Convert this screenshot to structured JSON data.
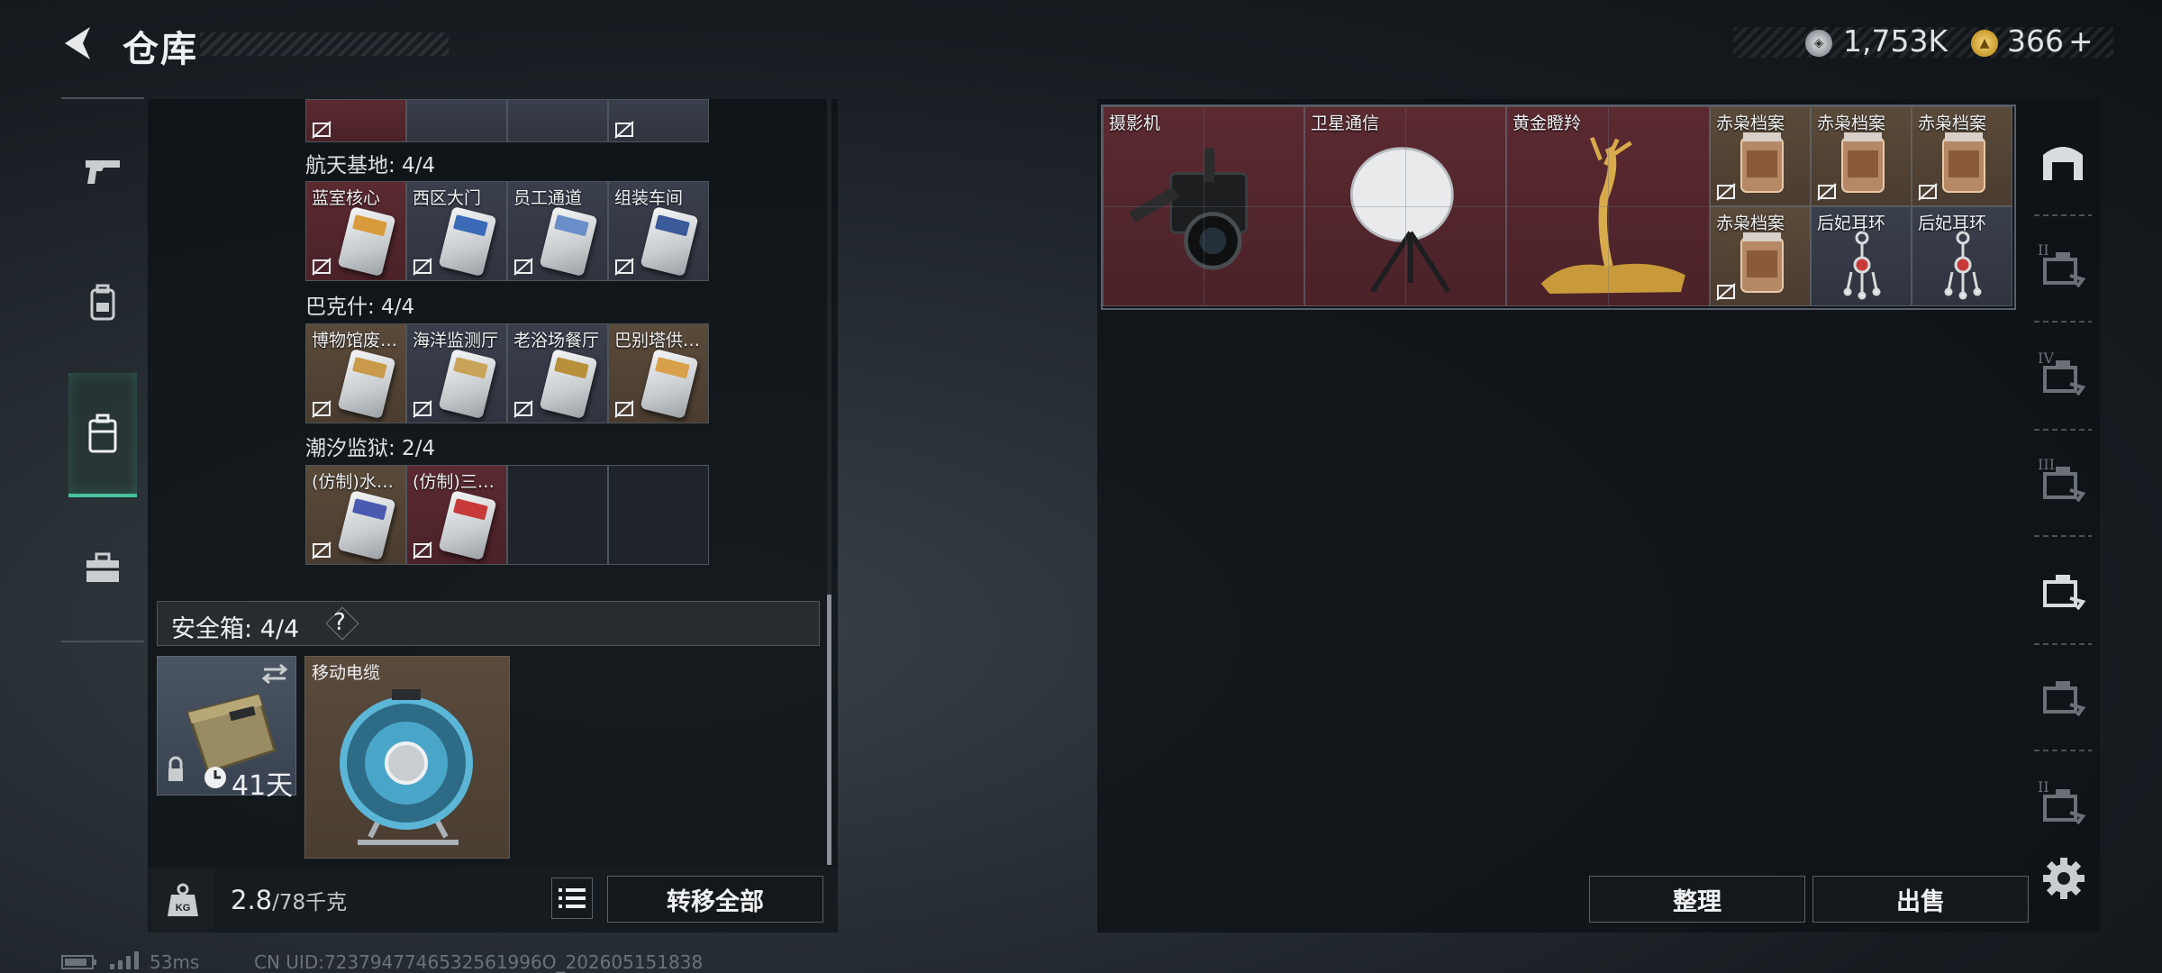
{
  "header": {
    "title": "仓库",
    "currency1": "1,753K",
    "currency2": "366",
    "currency2_suffix": "+"
  },
  "left_nav": {
    "items": [
      {
        "icon": "pistol-icon",
        "active": false
      },
      {
        "icon": "backpack-icon",
        "active": false
      },
      {
        "icon": "safe-case-icon",
        "active": true
      },
      {
        "icon": "toolbox-icon",
        "active": false
      }
    ]
  },
  "keycard_groups": [
    {
      "title": "航天基地: 4/4",
      "slots": [
        {
          "label": "蓝室核心",
          "bg": "red"
        },
        {
          "label": "西区大门",
          "bg": "gray"
        },
        {
          "label": "员工通道",
          "bg": "gray"
        },
        {
          "label": "组装车间",
          "bg": "gray"
        }
      ]
    },
    {
      "title": "巴克什: 4/4",
      "slots": [
        {
          "label": "博物馆废…",
          "bg": "brown"
        },
        {
          "label": "海洋监测厅",
          "bg": "gray"
        },
        {
          "label": "老浴场餐厅",
          "bg": "gray"
        },
        {
          "label": "巴别塔供…",
          "bg": "brown"
        }
      ]
    },
    {
      "title": "潮汐监狱: 2/4",
      "slots": [
        {
          "label": "(仿制)水…",
          "bg": "brown"
        },
        {
          "label": "(仿制)三…",
          "bg": "red"
        },
        {
          "label": "",
          "bg": "empty"
        },
        {
          "label": "",
          "bg": "empty"
        }
      ]
    }
  ],
  "safe_box": {
    "title": "安全箱: 4/4",
    "help": "?",
    "days": "41天",
    "item_label": "移动电缆"
  },
  "capacity": {
    "current": "2.8",
    "max": "/78千克",
    "kg_icon": "KG"
  },
  "buttons": {
    "transfer_all": "转移全部",
    "sort": "整理",
    "sell": "出售"
  },
  "storage_items": [
    {
      "label": "摄影机",
      "bg": "red",
      "icon": "camera-icon"
    },
    {
      "label": "卫星通信",
      "bg": "red",
      "icon": "satellite-dish-icon"
    },
    {
      "label": "黄金瞪羚",
      "bg": "red",
      "icon": "golden-gazelle-icon"
    },
    {
      "label": "赤枭档案",
      "bg": "brown",
      "icon": "archive-jar-icon"
    },
    {
      "label": "赤枭档案",
      "bg": "brown",
      "icon": "archive-jar-icon"
    },
    {
      "label": "赤枭档案",
      "bg": "brown",
      "icon": "archive-jar-icon"
    },
    {
      "label": "赤枭档案",
      "bg": "brown",
      "icon": "archive-jar-icon"
    },
    {
      "label": "后妃耳环",
      "bg": "gray",
      "icon": "earring-icon"
    },
    {
      "label": "后妃耳环",
      "bg": "gray",
      "icon": "earring-icon"
    }
  ],
  "right_nav": {
    "items": [
      {
        "icon": "container-icon",
        "roman": ""
      },
      {
        "icon": "add-storage-icon",
        "roman": "II"
      },
      {
        "icon": "storage-iv-icon",
        "roman": "IV"
      },
      {
        "icon": "storage-iii-icon",
        "roman": "III"
      },
      {
        "icon": "storage-active-icon",
        "roman": ""
      },
      {
        "icon": "storage-dim-icon",
        "roman": ""
      },
      {
        "icon": "storage-ii-icon",
        "roman": "II"
      }
    ]
  },
  "footer": {
    "ping": "53ms",
    "uid": "CN UID:7237947746532561996O_202605151838"
  },
  "colors": {
    "accent_green": "#46c49a",
    "rarity_red": "#5b2a31",
    "rarity_gray": "#3a3f4c",
    "rarity_brown": "#5a4a3a"
  }
}
